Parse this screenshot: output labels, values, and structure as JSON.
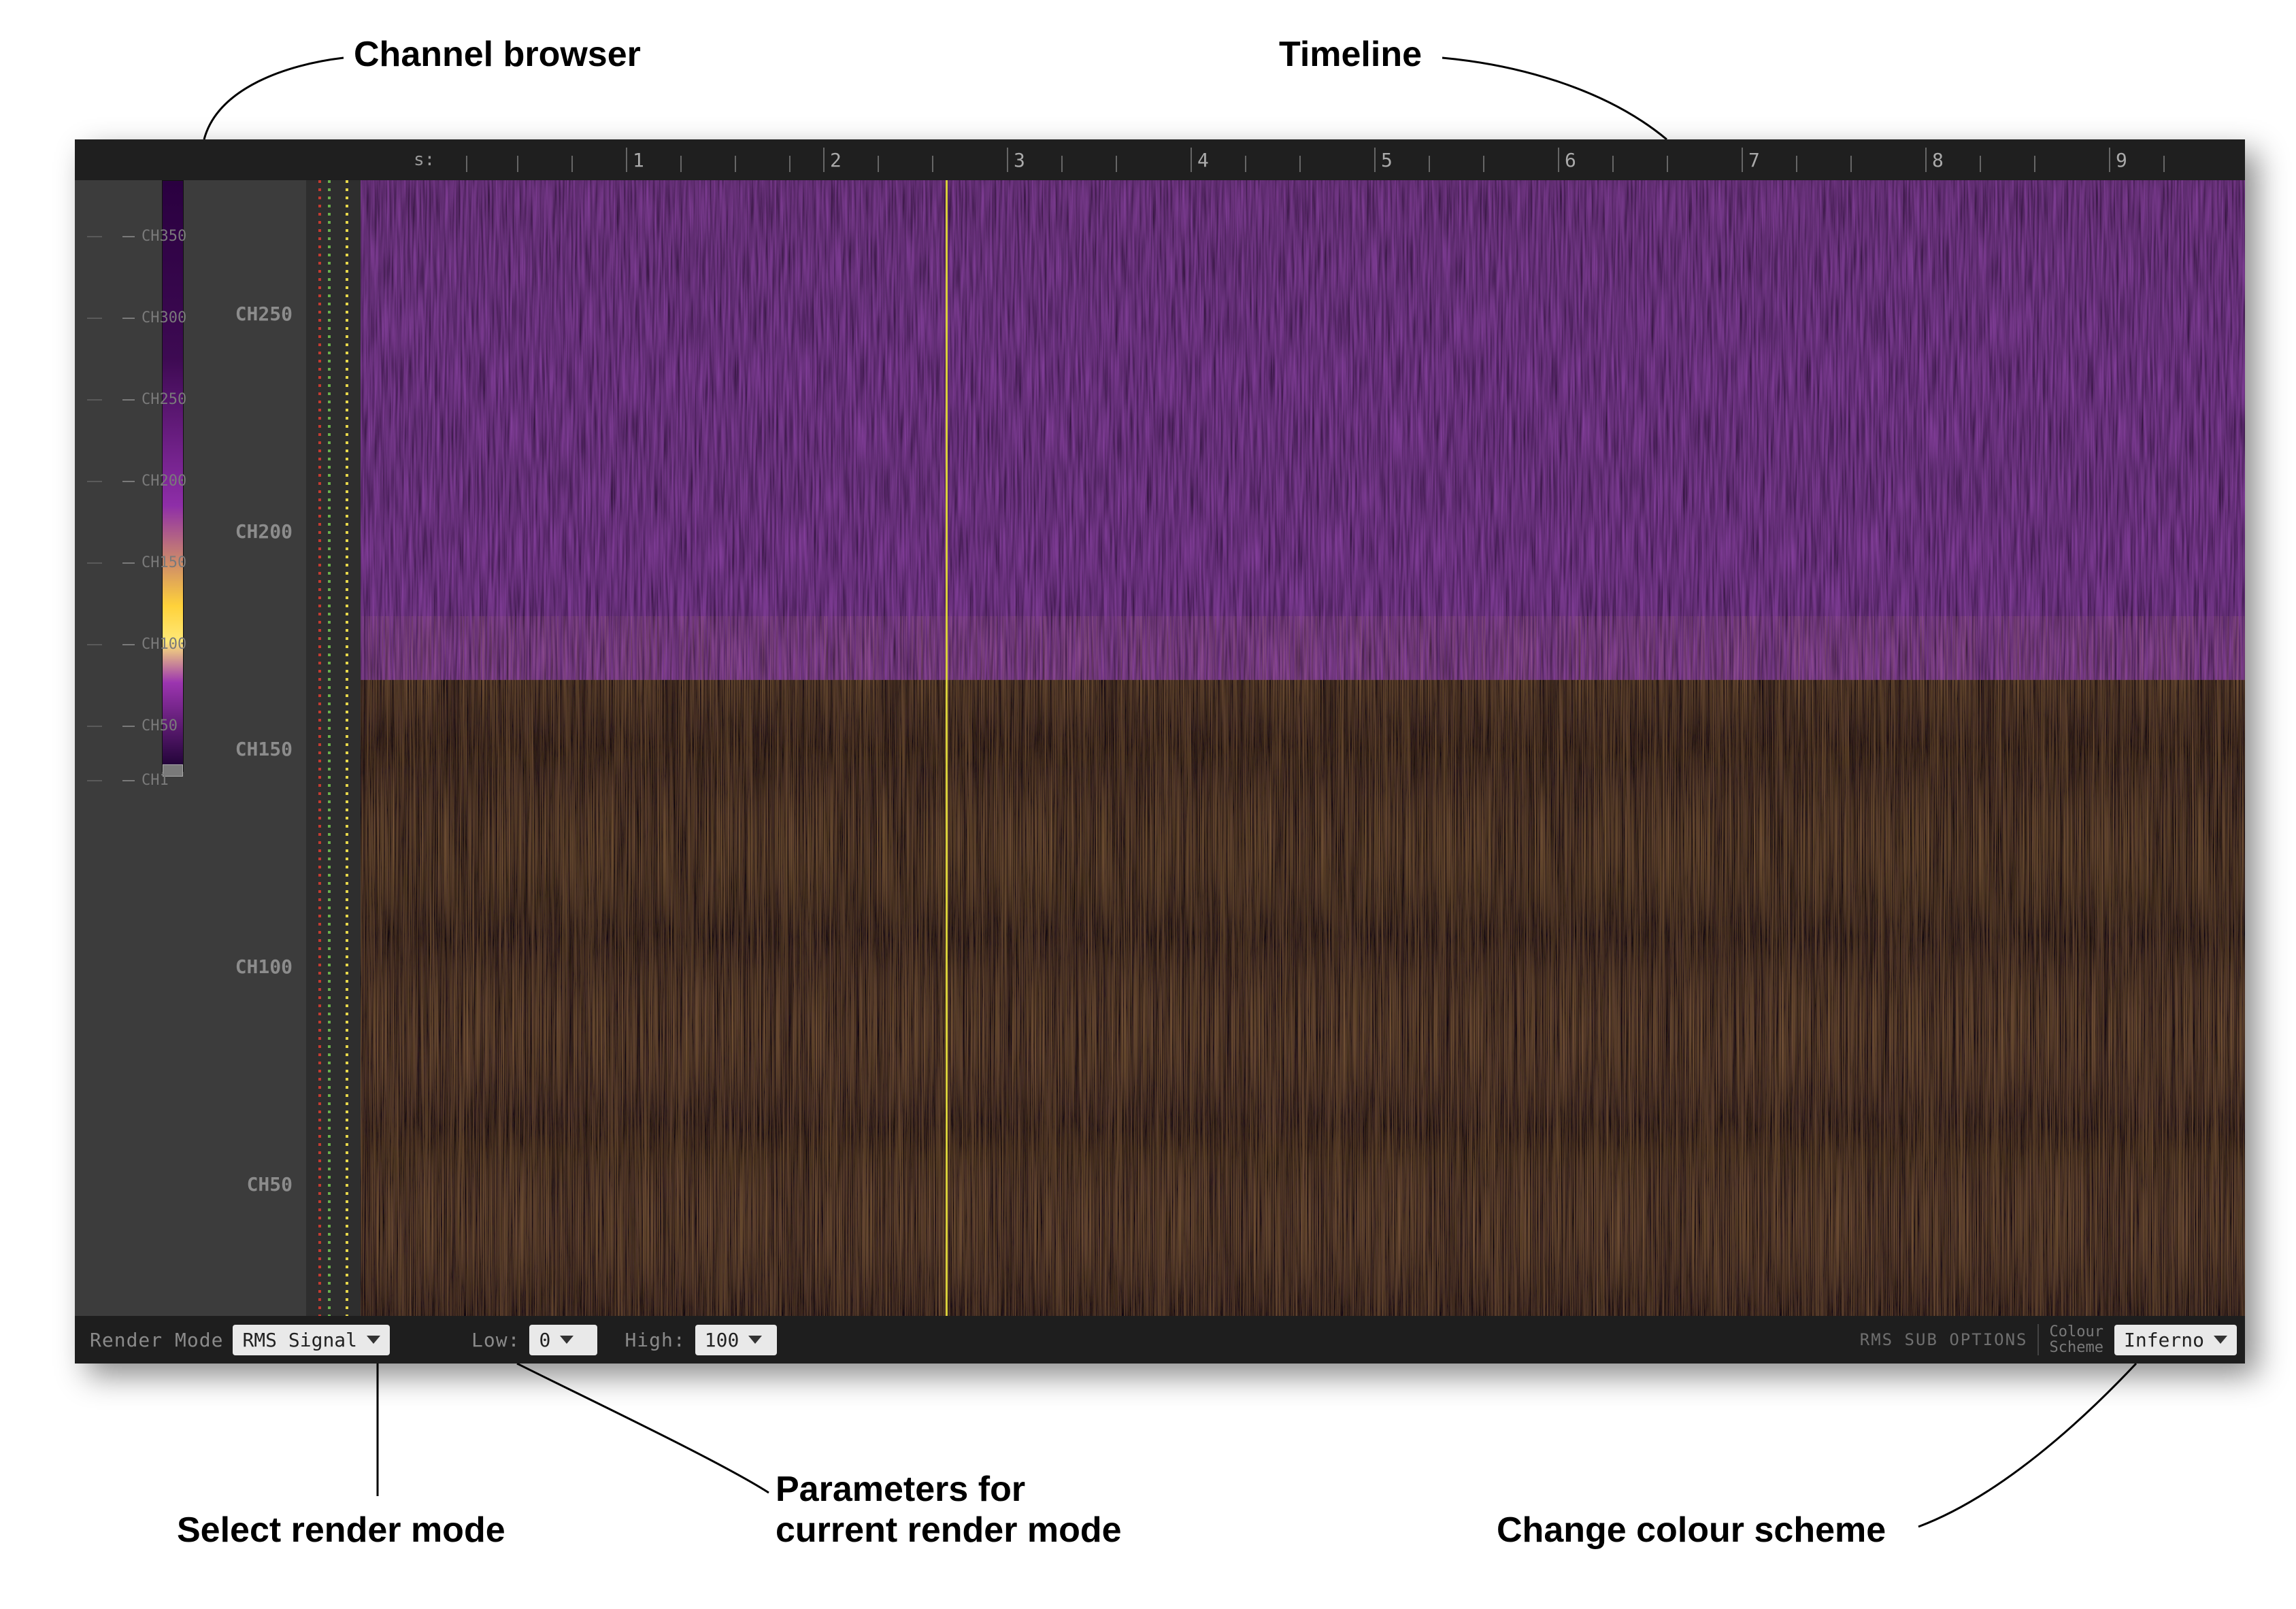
{
  "annotations": {
    "channel_browser": "Channel browser",
    "timeline": "Timeline",
    "select_render_mode": "Select render mode",
    "parameters": "Parameters for\ncurrent render mode",
    "change_colour_scheme": "Change colour scheme"
  },
  "timeline": {
    "unit_label": "s:",
    "ticks": [
      "1",
      "2",
      "3",
      "4",
      "5",
      "6",
      "7",
      "8",
      "9"
    ]
  },
  "channel_browser": {
    "mini_ticks": [
      "CH350",
      "CH300",
      "CH250",
      "CH200",
      "CH150",
      "CH100",
      "CH50",
      "CH1"
    ]
  },
  "channel_axis": {
    "labels": [
      "CH250",
      "CH200",
      "CH150",
      "CH100",
      "CH50"
    ]
  },
  "footer": {
    "render_mode_label": "Render Mode",
    "render_mode_value": "RMS Signal",
    "low_label": "Low:",
    "low_value": "0",
    "high_label": "High:",
    "high_value": "100",
    "sub_options_label": "RMS SUB OPTIONS",
    "colour_scheme_label": "Colour\nScheme",
    "colour_scheme_value": "Inferno"
  },
  "cursor_time_s": 3
}
